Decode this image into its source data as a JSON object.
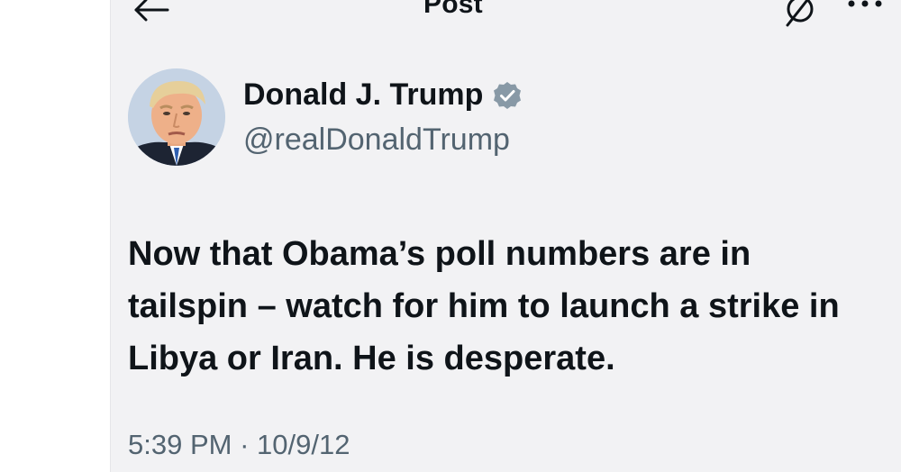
{
  "header": {
    "title": "Post",
    "back_icon": "arrow-left-icon",
    "share_icon": "share-icon",
    "more_icon": "more-horizontal-icon"
  },
  "author": {
    "name": "Donald J. Trump",
    "handle": "@realDonaldTrump",
    "verified": true,
    "verified_color": "#8899a6",
    "avatar": "profile-photo"
  },
  "tweet": {
    "lines": [
      "Now that Obama’s poll numbers are in",
      "tailspin – watch for him to launch a strike in",
      "Libya or Iran.  He is desperate."
    ],
    "time": "5:39 PM",
    "separator": "·",
    "date": "10/9/12"
  },
  "colors": {
    "text": "#0f1419",
    "secondary_text": "#536471",
    "background": "#f2f2f4"
  }
}
